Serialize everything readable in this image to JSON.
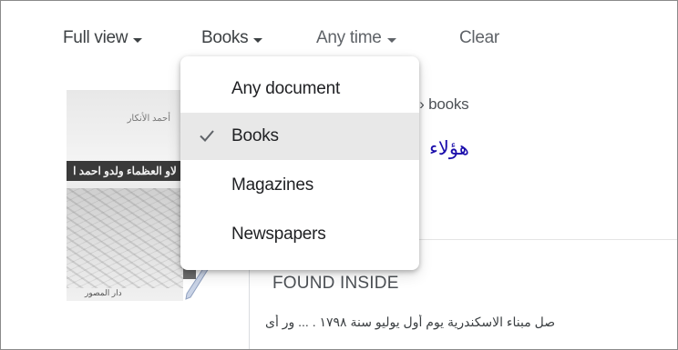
{
  "toolbar": {
    "full_view": "Full view",
    "books": "Books",
    "any_time": "Any time",
    "clear": "Clear"
  },
  "dropdown": {
    "items": [
      {
        "label": "Any document",
        "selected": false
      },
      {
        "label": "Books",
        "selected": true
      },
      {
        "label": "Magazines",
        "selected": false
      },
      {
        "label": "Newspapers",
        "selected": false
      }
    ]
  },
  "result": {
    "breadcrumb": "n.lb › books",
    "title": "هؤلاء",
    "found_inside_heading": "FOUND INSIDE",
    "snippet": "صل مبناء الاسكندرية يوم أول يوليو سنة ١٧٩٨ . ... ور أى"
  },
  "thumbnail": {
    "top_text": "أحمد الأنكار",
    "band_text": "لاو العظماء ولدو احمد ا",
    "bottom_text": "دار المصور"
  },
  "colors": {
    "link_blue": "#1a0dab",
    "selected_bg": "#e8e8e8",
    "accent_blue": "#4f8ee8"
  }
}
